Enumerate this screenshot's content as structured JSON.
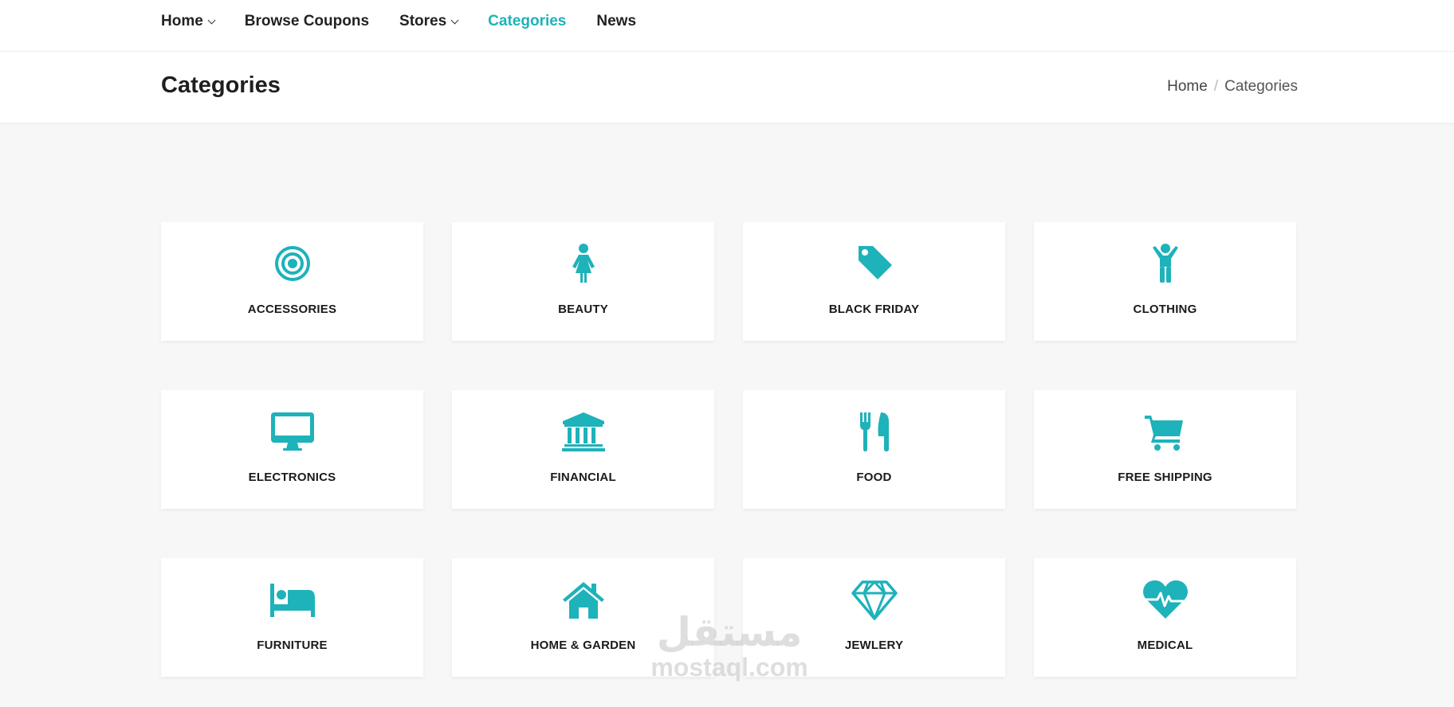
{
  "nav": {
    "items": [
      {
        "label": "Home",
        "has_dropdown": true,
        "active": false
      },
      {
        "label": "Browse Coupons",
        "has_dropdown": false,
        "active": false
      },
      {
        "label": "Stores",
        "has_dropdown": true,
        "active": false
      },
      {
        "label": "Categories",
        "has_dropdown": false,
        "active": true
      },
      {
        "label": "News",
        "has_dropdown": false,
        "active": false
      }
    ]
  },
  "page": {
    "title": "Categories",
    "breadcrumb": {
      "home": "Home",
      "separator": "/",
      "current": "Categories"
    }
  },
  "accent_color": "#1eb2ba",
  "categories": [
    {
      "label": "ACCESSORIES",
      "icon": "target-icon"
    },
    {
      "label": "BEAUTY",
      "icon": "female-icon"
    },
    {
      "label": "BLACK FRIDAY",
      "icon": "tag-icon"
    },
    {
      "label": "CLOTHING",
      "icon": "child-icon"
    },
    {
      "label": "ELECTRONICS",
      "icon": "desktop-icon"
    },
    {
      "label": "FINANCIAL",
      "icon": "bank-icon"
    },
    {
      "label": "FOOD",
      "icon": "cutlery-icon"
    },
    {
      "label": "FREE SHIPPING",
      "icon": "shopping-cart-icon"
    },
    {
      "label": "FURNITURE",
      "icon": "bed-icon"
    },
    {
      "label": "HOME & GARDEN",
      "icon": "home-icon"
    },
    {
      "label": "JEWLERY",
      "icon": "diamond-icon"
    },
    {
      "label": "MEDICAL",
      "icon": "heartbeat-icon"
    }
  ],
  "watermark": {
    "arabic": "مستقل",
    "latin": "mostaql.com"
  }
}
